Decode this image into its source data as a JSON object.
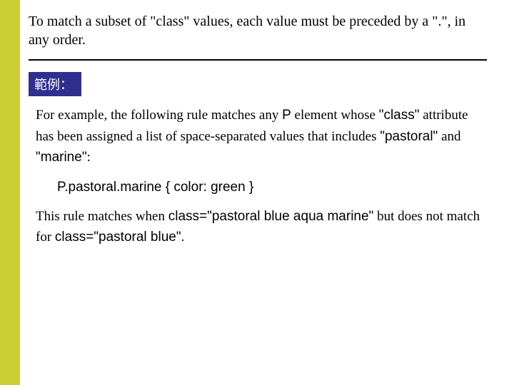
{
  "intro": "To match a subset of \"class\" values, each value must be preceded by a \".\", in any order.",
  "chip_label": "範例：",
  "p1a": "For example, the following rule matches any ",
  "p1_code1": "P",
  "p1b": " element whose ",
  "p1_code2": "\"class\"",
  "p1c": " attribute has been assigned a list of space-separated values that includes ",
  "p1_code3": "\"pastoral\"",
  "p1d": " and ",
  "p1_code4": "\"marine\"",
  "p1e": ":",
  "code_line": "P.pastoral.marine { color: green }",
  "p2a": "This rule matches when ",
  "p2_code1": "class=\"pastoral blue aqua marine\"",
  "p2b": " but does not match for ",
  "p2_code2": "class=\"pastoral blue\"",
  "p2c": "."
}
